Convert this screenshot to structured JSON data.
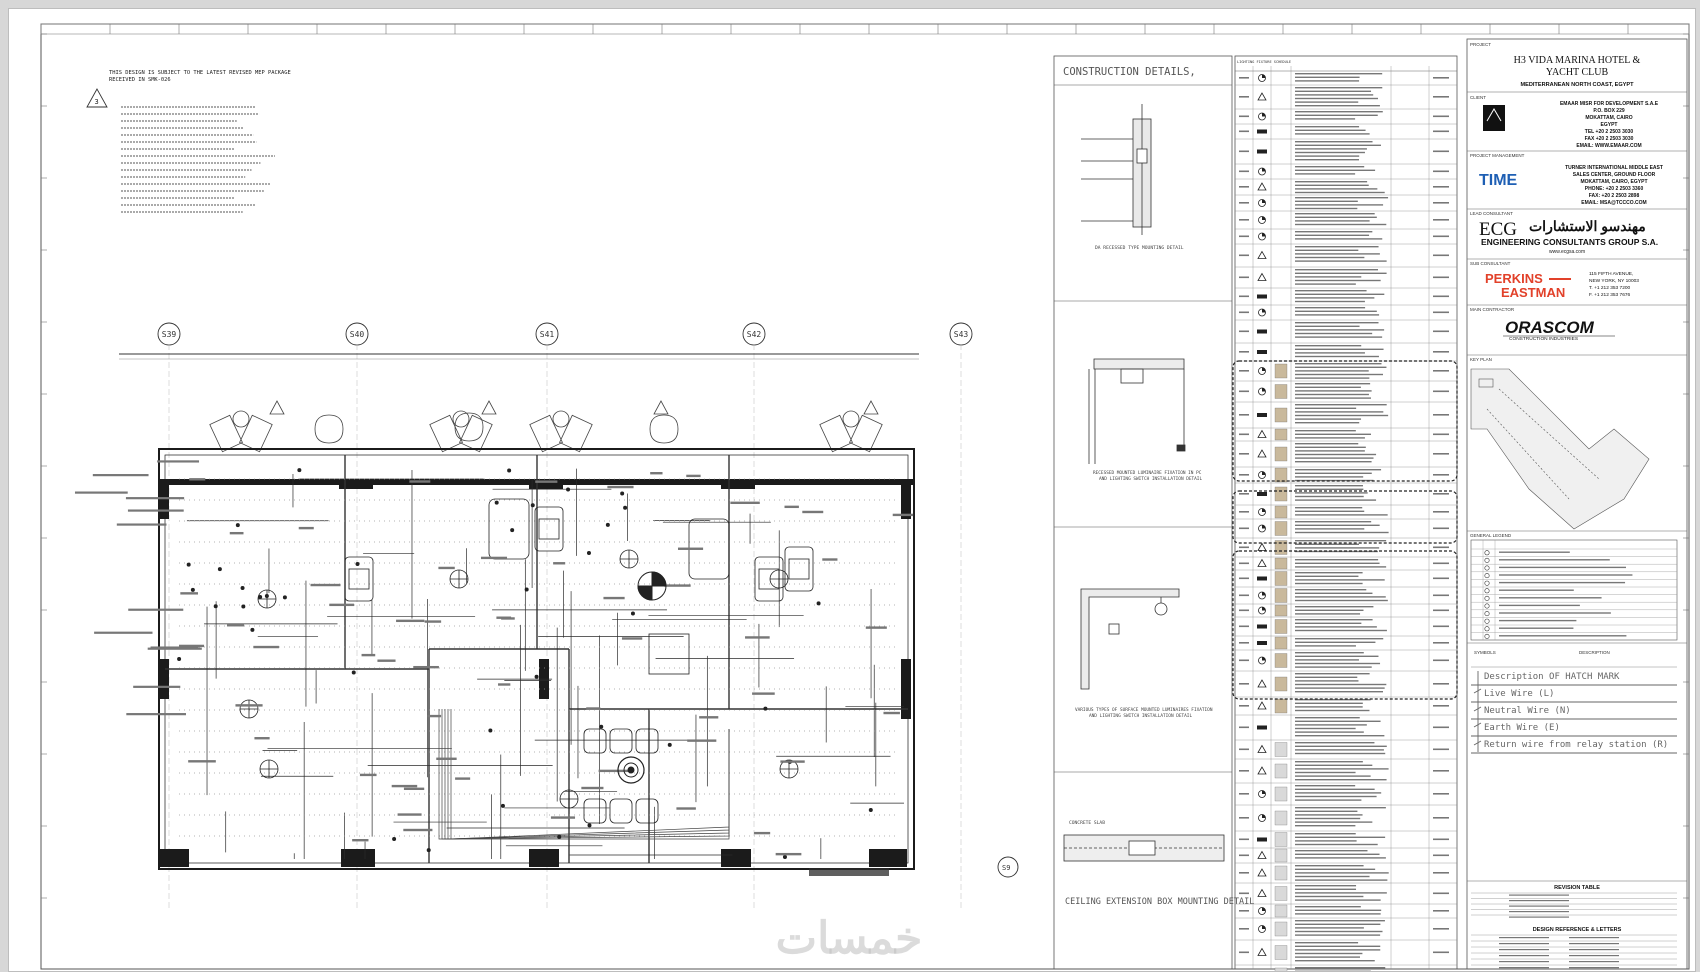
{
  "general_notes": {
    "line1": "THIS DESIGN IS SUBJECT TO THE LATEST REVISED MEP PACKAGE",
    "line2": "RECEIVED IN SMK-026",
    "revision_tag": "3"
  },
  "axes": [
    "S39",
    "S40",
    "S41",
    "S42",
    "S43"
  ],
  "details": {
    "header": "CONSTRUCTION DETAILS,",
    "recessed_caption": "DA RECESSED TYPE MOUNTING DETAIL",
    "surface_caption": "RECESSED MOUNTED LUMINAIRE FIXATION IN PC AND LIGHTING SWITCH INSTALLATION DETAIL",
    "various_caption": "VARIOUS TYPES OF SURFACE MOUNTED LUMINAIRES FIXATION AND LIGHTING SWITCH INSTALLATION DETAIL",
    "ceiling_caption": "CEILING EXTENSION BOX MOUNTING DETAIL",
    "concrete_label": "CONCRETE SLAB"
  },
  "legend_schedule_title": "LIGHTING FIXTURE SCHEDULE",
  "title_block": {
    "project_label": "PROJECT",
    "project_name_1": "H3 VIDA MARINA HOTEL  &",
    "project_name_2": "YACHT CLUB",
    "location": "MEDITERRANEAN NORTH COAST, EGYPT",
    "client_label": "CLIENT",
    "client": {
      "name": "EMAAR MISR FOR DEVELOPMENT S.A.E",
      "line2": "P.O. BOX 229",
      "line3": "MOKATTAM, CAIRO",
      "line4": "EGYPT",
      "tel": "TEL +20 2 2503 3030",
      "fax": "FAX +20 2 2503 3030",
      "email": "EMAIL: WWW.EMAAR.COM"
    },
    "pm_label": "PROJECT MANAGEMENT",
    "pm_logo": "TIME",
    "pm": {
      "name": "TURNER INTERNATIONAL MIDDLE EAST",
      "line2": "SALES CENTER, GROUND FLOOR",
      "line3": "MOKATTAM, CAIRO, EGYPT",
      "phone": "PHONE: +20 2 2503 3360",
      "fax": "FAX: +20 2 2503 2898",
      "email": "EMAIL: MSA@TCCCO.COM"
    },
    "lead_label": "LEAD CONSULTANT",
    "ecg_logo": "ECG",
    "ecg_arabic": "مهندسو الاستشارات",
    "ecg_name": "ENGINEERING CONSULTANTS GROUP S.A.",
    "ecg_web": "www.ecgsa.com",
    "sub_label": "SUB CONSULTANT",
    "pe_line1": "PERKINS",
    "pe_line2": "EASTMAN",
    "pe_addr1": "115 FIFTH AVENUE,",
    "pe_addr2": "NEW YORK, NY 10003",
    "pe_tel": "T.   +1 212 353 7200",
    "pe_fax": "F.   +1 212 353 7676",
    "mc_label": "MAIN CONTRACTOR",
    "orascom": "ORASCOM",
    "orascom_sub": "CONSTRUCTION INDUSTRIES",
    "keyplan_label": "KEY PLAN",
    "legend_label": "GENERAL LEGEND",
    "symbols_label": "SYMBOLS",
    "description_label": "DESCRIPTION",
    "hatch_mark": "Description OF HATCH MARK",
    "live_wire": "Live Wire        (L)",
    "neutral_wire": "Neutral Wire    (N)",
    "earth_wire": "Earth Wire       (E)",
    "return_wire": "Return wire from relay station (R)",
    "revision_table": "REVISION TABLE",
    "design_reference": "DESIGN REFERENCE & LETTERS"
  },
  "watermark": "خمسات",
  "colors": {
    "line": "#1b1b1b",
    "grid": "#b0b0b0",
    "pe_red": "#e2412a",
    "time_blue": "#1e5fb4",
    "page": "#ffffff",
    "frame_bg": "#d7d7d7"
  }
}
